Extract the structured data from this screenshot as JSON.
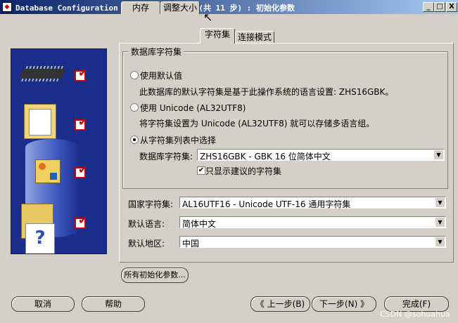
{
  "window": {
    "title": "Database Configuration Assistant, 步骤 9(共 11 步) : 初始化参数",
    "minimize": "_",
    "maximize": "□",
    "close": "X"
  },
  "tabs": [
    {
      "label": "内存"
    },
    {
      "label": "调整大小"
    },
    {
      "label": "字符集",
      "active": true
    },
    {
      "label": "连接模式"
    }
  ],
  "charset_group": {
    "title": "数据库字符集",
    "option_default": "使用默认值",
    "default_desc": "此数据库的默认字符集是基于此操作系统的语言设置: ZHS16GBK。",
    "option_unicode": "使用 Unicode (AL32UTF8)",
    "unicode_desc": "将字符集设置为 Unicode (AL32UTF8) 就可以存储多语言组。",
    "option_list": "从字符集列表中选择",
    "selected_option": "从字符集列表中选择",
    "db_charset_label": "数据库字符集:",
    "db_charset_value": "ZHS16GBK - GBK 16 位简体中文",
    "recommended_only_label": "只显示建议的字符集",
    "recommended_only_checked": true
  },
  "national": {
    "label": "国家字符集:",
    "value": "AL16UTF16 - Unicode UTF-16 通用字符集"
  },
  "language": {
    "label": "默认语言:",
    "value": "简体中文"
  },
  "territory": {
    "label": "默认地区:",
    "value": "中国"
  },
  "all_params_button": "所有初始化参数...",
  "footer": {
    "cancel": "取消",
    "help": "帮助",
    "back": "上一步(B)",
    "next": "下一步(N)",
    "finish": "完成(F)"
  },
  "watermark": "CSDN @sohuahua",
  "colors": {
    "titlebar_start": "#0a246a",
    "titlebar_end": "#a6caf0",
    "side_panel": "#1b2d8a",
    "check_red": "#cc0000",
    "window_face": "#d4d0c8"
  },
  "icons": [
    "memory-chip-icon",
    "document-folder-icon",
    "shapes-database-icon",
    "question-folder-icon",
    "check-icon",
    "radio-icon",
    "dropdown-arrow-icon",
    "back-arrow-icon",
    "next-arrow-icon"
  ]
}
